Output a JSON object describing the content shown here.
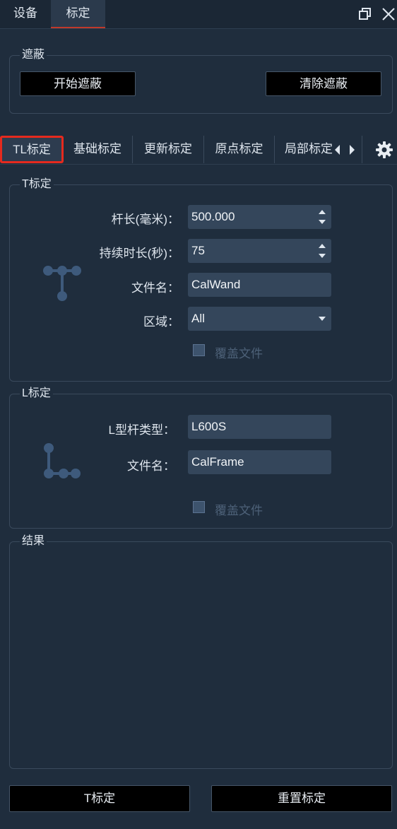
{
  "top_tabs": [
    "设备",
    "标定"
  ],
  "mask": {
    "title": "遮蔽",
    "start_label": "开始遮蔽",
    "clear_label": "清除遮蔽"
  },
  "sub_tabs": [
    "TL标定",
    "基础标定",
    "更新标定",
    "原点标定",
    "局部标定"
  ],
  "t_calib": {
    "title": "T标定",
    "rod_length_label": "杆长(毫米)：",
    "rod_length_value": "500.000",
    "duration_label": "持续时长(秒)：",
    "duration_value": "75",
    "filename_label": "文件名：",
    "filename_value": "CalWand",
    "region_label": "区域：",
    "region_value": "All",
    "overwrite_label": "覆盖文件"
  },
  "l_calib": {
    "title": "L标定",
    "rod_type_label": "L型杆类型：",
    "rod_type_value": "L600S",
    "filename_label": "文件名：",
    "filename_value": "CalFrame",
    "overwrite_label": "覆盖文件"
  },
  "result": {
    "title": "结果"
  },
  "footer": {
    "t_calib_label": "T标定",
    "reset_label": "重置标定"
  },
  "colors": {
    "background": "#1f2d3d",
    "field": "#34465b",
    "active_tab_border": "#e52a1e",
    "icon": "#3e5a7c"
  },
  "icons": [
    "restore-icon",
    "close-icon",
    "scroll-left-icon",
    "scroll-right-icon",
    "gear-icon",
    "t-wand-icon",
    "l-frame-icon"
  ]
}
